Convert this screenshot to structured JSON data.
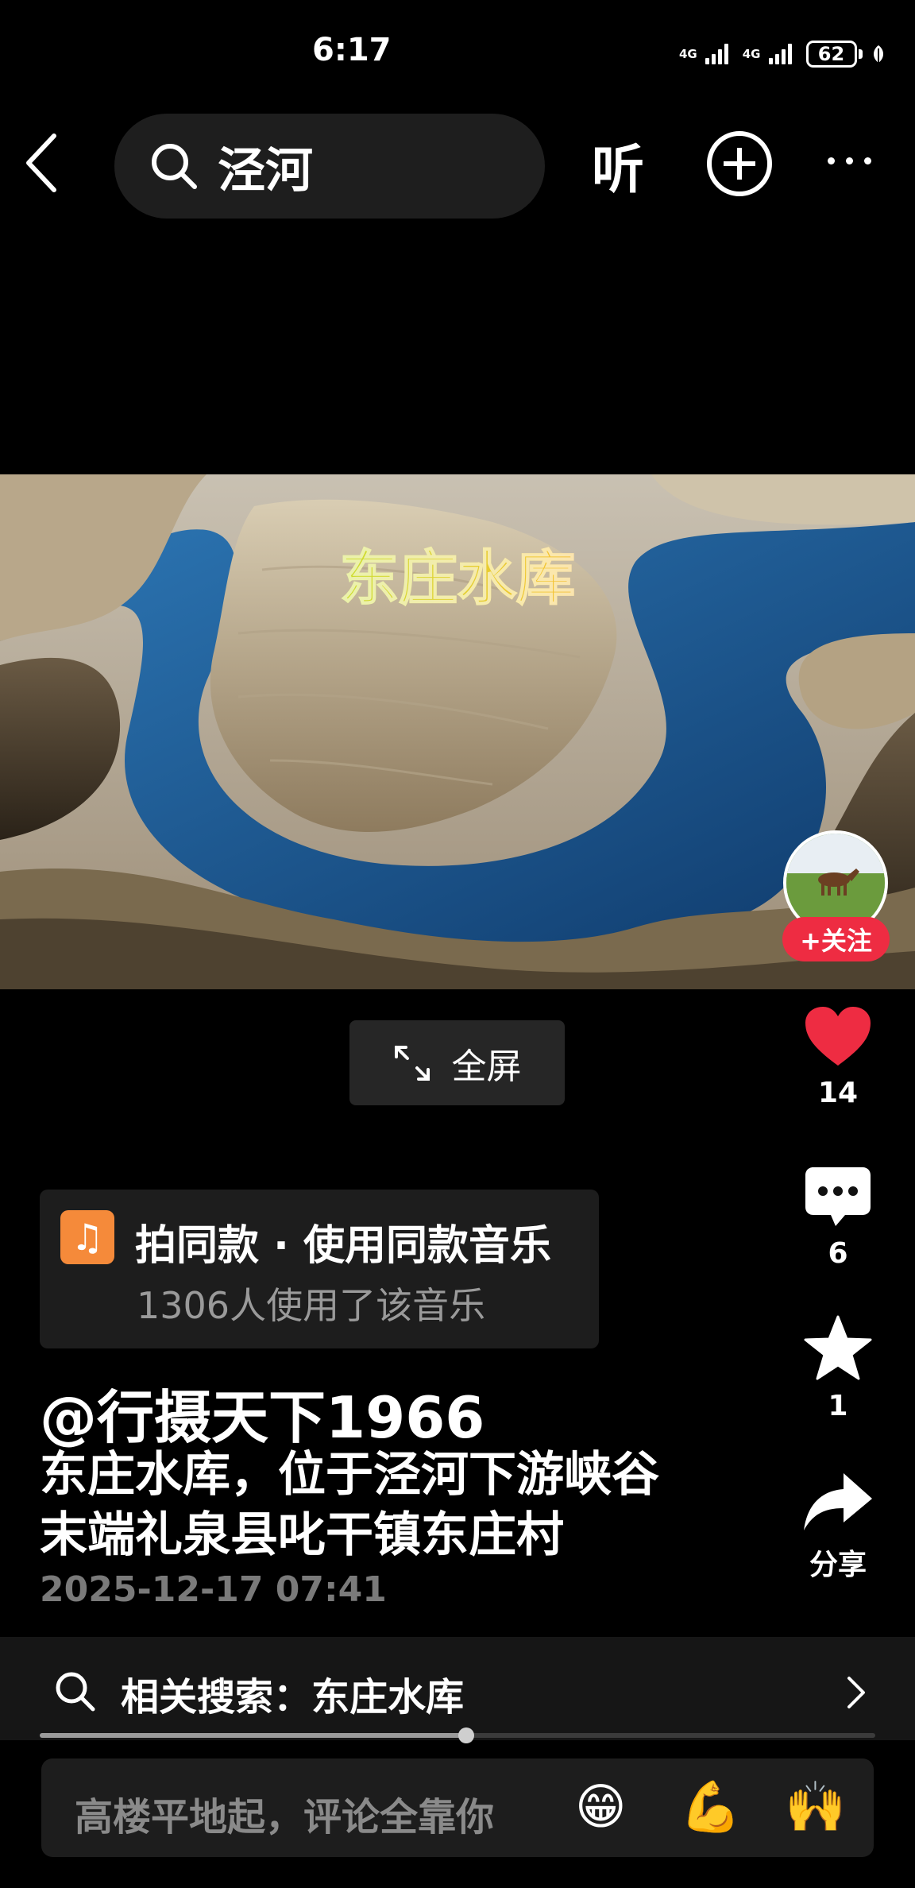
{
  "status_bar": {
    "time": "6:17",
    "network_1": "4G",
    "network_2": "4G",
    "battery": "62"
  },
  "top_bar": {
    "search_text": "泾河",
    "listen_label": "听",
    "icons": [
      "back-icon",
      "search-icon",
      "plus-circle-icon",
      "more-icon"
    ]
  },
  "video": {
    "overlay_title": "东庄水库",
    "follow_label": "+关注",
    "fullscreen_label": "全屏"
  },
  "actions": {
    "like_count": "14",
    "comment_count": "6",
    "favorite_count": "1",
    "share_label": "分享",
    "like_color": "#ee2c42"
  },
  "music": {
    "title": "拍同款 · 使用同款音乐",
    "subtitle": "1306人使用了该音乐"
  },
  "post": {
    "author": "@行摄天下1966",
    "caption_line1": "东庄水库，位于泾河下游峡谷",
    "caption_line2": "末端礼泉县叱干镇东庄村",
    "date": "2025-12-17 07:41"
  },
  "related_search": {
    "label": "相关搜索：东庄水库"
  },
  "playback": {
    "progress": 0.51
  },
  "comment_bar": {
    "placeholder": "高楼平地起，评论全靠你",
    "emojis": [
      "😁",
      "💪",
      "🙌"
    ]
  }
}
